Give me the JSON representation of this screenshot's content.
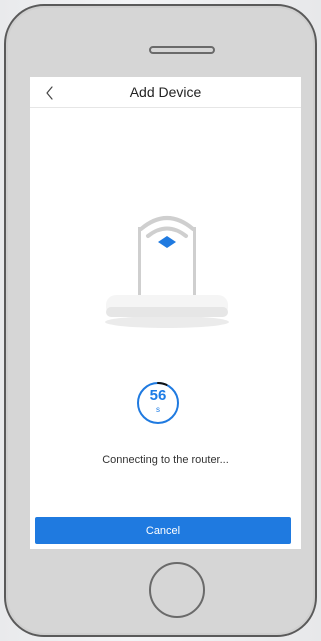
{
  "header": {
    "title": "Add Device"
  },
  "countdown": {
    "value": "56",
    "unit": "s",
    "progress_fraction": 0.93
  },
  "status": {
    "text": "Connecting to the router..."
  },
  "actions": {
    "cancel_label": "Cancel"
  },
  "colors": {
    "accent": "#1f7ae0",
    "phone_frame": "#d6d6d6"
  },
  "icons": {
    "back": "chevron-left-icon",
    "wifi": "wifi-icon",
    "router": "router-icon"
  }
}
